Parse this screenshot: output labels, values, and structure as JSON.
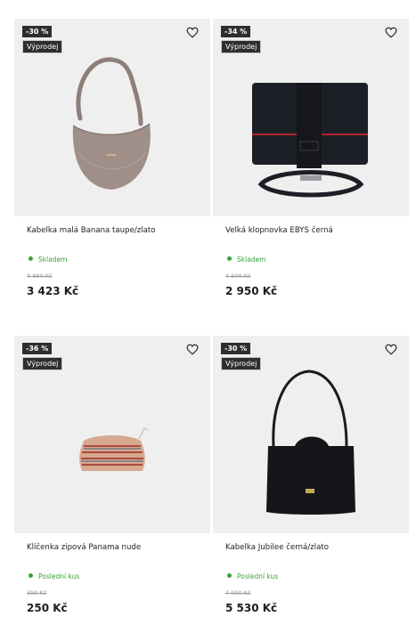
{
  "products": [
    {
      "discount": "-30 %",
      "sale_label": "Výprodej",
      "name": "Kabelka malá Banana taupe/zlato",
      "stock": "Skladem",
      "old_price": "4 890 Kč",
      "price": "3 423 Kč",
      "wishlist_icon": "heart-icon"
    },
    {
      "discount": "-34 %",
      "sale_label": "Výprodej",
      "name": "Velká klopnovka EBYS černá",
      "stock": "Skladem",
      "old_price": "4 500 Kč",
      "price": "2 950 Kč",
      "wishlist_icon": "heart-icon"
    },
    {
      "discount": "-36 %",
      "sale_label": "Výprodej",
      "name": "Klíčenka zipová Panama nude",
      "stock": "Poslední kus",
      "old_price": "390 Kč",
      "price": "250 Kč",
      "wishlist_icon": "heart-icon"
    },
    {
      "discount": "-30 %",
      "sale_label": "Výprodej",
      "name": "Kabelka Jubilee černá/zlato",
      "stock": "Poslední kus",
      "old_price": "7 900 Kč",
      "price": "5 530 Kč",
      "wishlist_icon": "heart-icon"
    }
  ],
  "colors": {
    "badge_bg": "#2e2e2e",
    "stock_green": "#3aa335",
    "image_bg": "#efefef"
  }
}
